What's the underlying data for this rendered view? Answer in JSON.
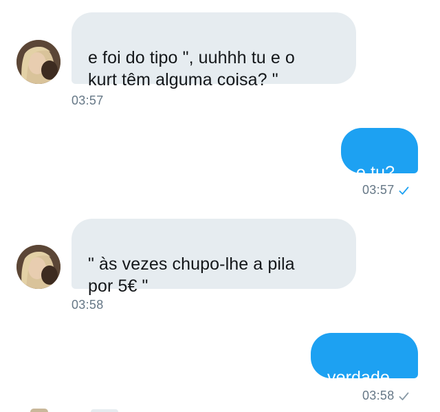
{
  "messages": [
    {
      "direction": "incoming",
      "text": "e foi do tipo \", uuhhh tu e o\nkurt têm alguma coisa? \"",
      "time": "03:57"
    },
    {
      "direction": "outgoing",
      "text": "e tu?",
      "time": "03:57",
      "status_icon": "check-icon",
      "status_color": "#1da1f2"
    },
    {
      "direction": "incoming",
      "text": "\" às vezes chupo-lhe a pila\npor 5€ \"",
      "time": "03:58"
    },
    {
      "direction": "outgoing",
      "text": "verdade",
      "time": "03:58",
      "status_icon": "check-icon",
      "status_color": "#8899a6"
    }
  ],
  "colors": {
    "incoming_bubble": "#e6ecf0",
    "outgoing_bubble": "#1da1f2",
    "timestamp": "#657786"
  }
}
